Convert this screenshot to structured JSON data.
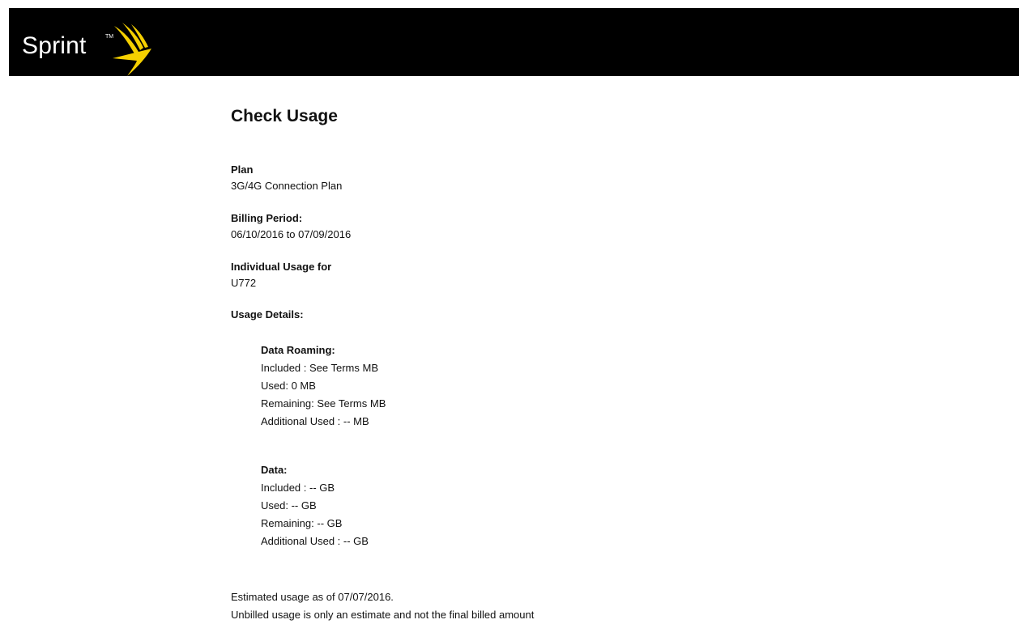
{
  "header": {
    "brand": "Sprint",
    "brand_tm": "TM",
    "background": "#000000",
    "accent": "#f5d000"
  },
  "page": {
    "title": "Check Usage"
  },
  "plan": {
    "label": "Plan",
    "value": "3G/4G Connection Plan"
  },
  "billing": {
    "label": "Billing Period:",
    "value": "06/10/2016 to 07/09/2016"
  },
  "individual": {
    "label": "Individual Usage for",
    "value": "U772"
  },
  "usage_details": {
    "label": "Usage Details:",
    "data_roaming": {
      "heading": "Data Roaming:",
      "lines": [
        "Included : See Terms MB",
        "Used: 0 MB",
        "Remaining: See Terms MB",
        "Additional Used : -- MB"
      ]
    },
    "data": {
      "heading": "Data:",
      "lines": [
        "Included :  -- GB",
        "Used: -- GB",
        "Remaining:  -- GB",
        "Additional Used : -- GB"
      ]
    }
  },
  "footer": {
    "estimate": "Estimated usage as of 07/07/2016.",
    "disclaimer": "Unbilled usage is only an estimate and not the final billed amount"
  }
}
